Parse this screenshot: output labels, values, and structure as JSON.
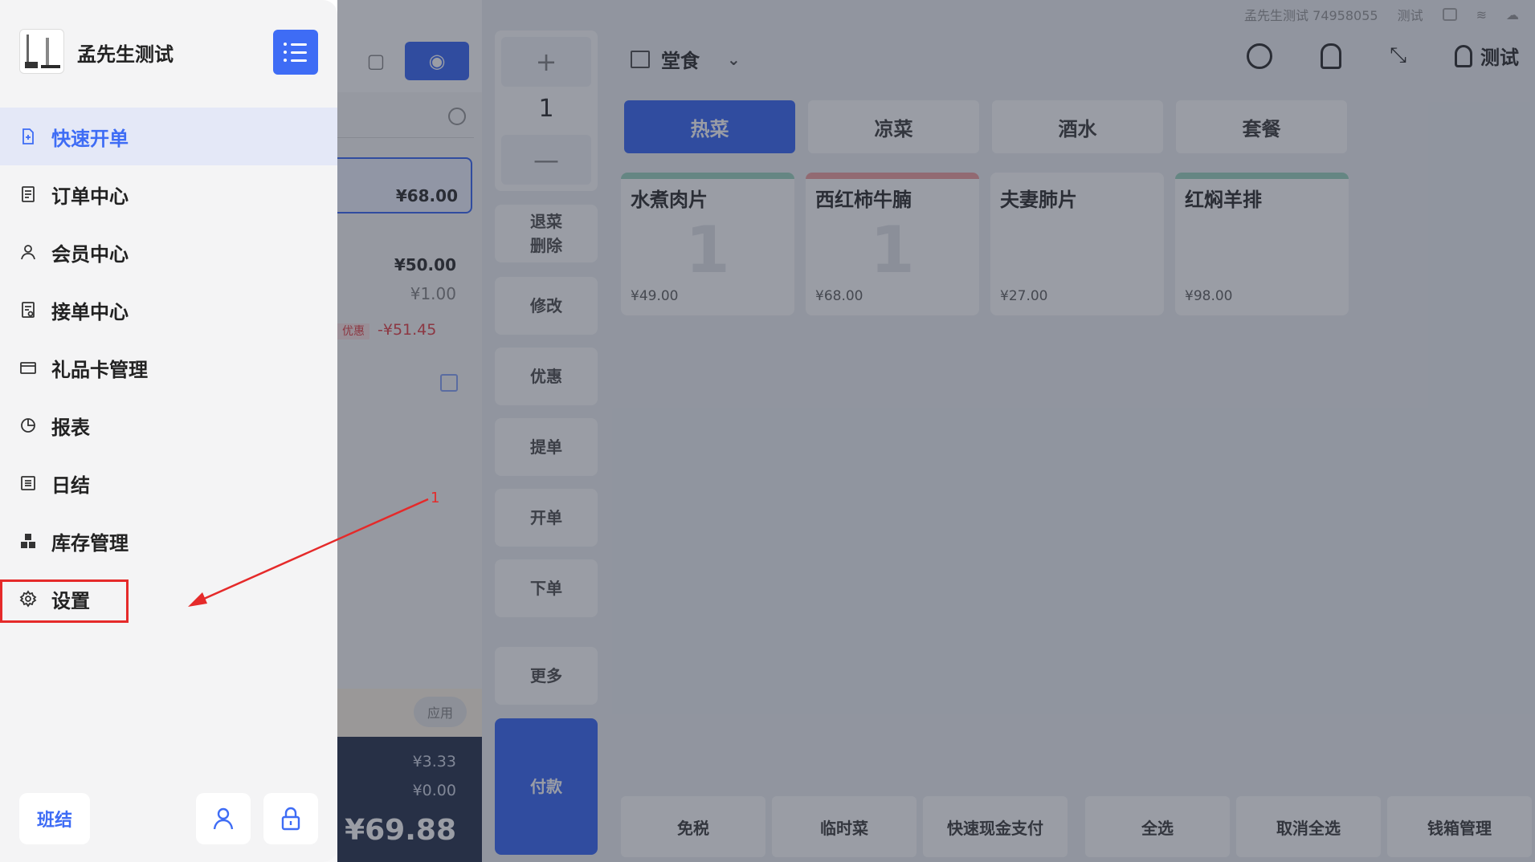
{
  "drawer": {
    "store_name": "孟先生测试",
    "menu": [
      {
        "label": "快速开单",
        "icon": "new-order-icon",
        "active": true
      },
      {
        "label": "订单中心",
        "icon": "order-list-icon",
        "active": false
      },
      {
        "label": "会员中心",
        "icon": "member-icon",
        "active": false
      },
      {
        "label": "接单中心",
        "icon": "receive-order-icon",
        "active": false
      },
      {
        "label": "礼品卡管理",
        "icon": "gift-card-icon",
        "active": false
      },
      {
        "label": "报表",
        "icon": "pie-chart-icon",
        "active": false
      },
      {
        "label": "日结",
        "icon": "daily-close-icon",
        "active": false
      },
      {
        "label": "库存管理",
        "icon": "inventory-icon",
        "active": false
      },
      {
        "label": "设置",
        "icon": "gear-icon",
        "active": false
      }
    ],
    "footer": {
      "shift_label": "班结"
    }
  },
  "annotation": {
    "number": "1",
    "color": "#e52a2a"
  },
  "status_bar": {
    "store_id": "孟先生测试 74958055",
    "user": "测试"
  },
  "header": {
    "dining_mode": "堂食",
    "user_name": "测试"
  },
  "categories": [
    {
      "label": "热菜",
      "active": true
    },
    {
      "label": "凉菜",
      "active": false
    },
    {
      "label": "酒水",
      "active": false
    },
    {
      "label": "套餐",
      "active": false
    }
  ],
  "dishes": [
    {
      "name": "水煮肉片",
      "price": "¥49.00",
      "count": "1",
      "bar_color": "#9fd6c1"
    },
    {
      "name": "西红柿牛腩",
      "price": "¥68.00",
      "count": "1",
      "bar_color": "#f0a2a2"
    },
    {
      "name": "夫妻肺片",
      "price": "¥27.00",
      "count": "",
      "bar_color": "#ffffff"
    },
    {
      "name": "红焖羊排",
      "price": "¥98.00",
      "count": "",
      "bar_color": "#9fd6c1"
    }
  ],
  "quantity": {
    "value": "1",
    "plus": "+",
    "minus": "—"
  },
  "side_actions": {
    "return_delete": "退菜\n删除",
    "modify": "修改",
    "discount": "优惠",
    "pickup": "提单",
    "open_order": "开单",
    "place_order": "下单",
    "more": "更多",
    "pay": "付款"
  },
  "bottom_actions": [
    "免税",
    "临时菜",
    "快速现金支付",
    "全选",
    "取消全选",
    "钱箱管理"
  ],
  "order_panel": {
    "selected_item_price": "¥68.00",
    "subtotal": "¥50.00",
    "extra": "¥1.00",
    "discount_tag": "优惠",
    "discount_value": "-¥51.45",
    "apply_label": "应用",
    "tax": "¥3.33",
    "tip": "¥0.00",
    "total": "¥69.88"
  },
  "colors": {
    "accent": "#3e6cf5",
    "annotation": "#e52a2a"
  }
}
